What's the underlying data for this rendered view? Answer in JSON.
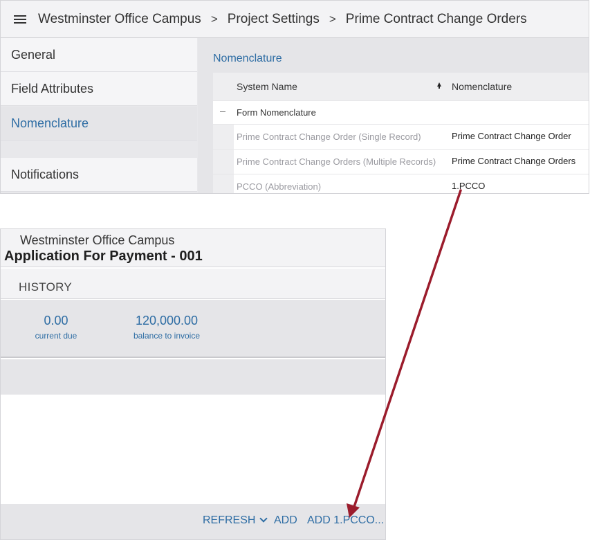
{
  "breadcrumb": [
    "Westminster Office Campus",
    "Project Settings",
    "Prime Contract Change Orders"
  ],
  "breadcrumb_separator": ">",
  "sidebar": {
    "items": [
      {
        "label": "General"
      },
      {
        "label": "Field Attributes"
      },
      {
        "label": "Nomenclature",
        "active": true
      },
      {
        "label": "Notifications"
      }
    ]
  },
  "nomenclature": {
    "section_title": "Nomenclature",
    "columns": {
      "system_name": "System Name",
      "nomenclature": "Nomenclature"
    },
    "group_label": "Form Nomenclature",
    "rows": [
      {
        "system": "Prime Contract Change Order (Single Record)",
        "value": "Prime Contract Change Order"
      },
      {
        "system": "Prime Contract Change Orders (Multiple Records)",
        "value": "Prime Contract Change Orders"
      },
      {
        "system": "PCCO (Abbreviation)",
        "value": "1.PCCO"
      }
    ]
  },
  "payment": {
    "project": "Westminster Office Campus",
    "title": "Application For Payment - 001",
    "history_label": "HISTORY",
    "current_due_value": "0.00",
    "current_due_label": "current due",
    "balance_value": "120,000.00",
    "balance_label": "balance to invoice"
  },
  "footer": {
    "refresh_label": "REFRESH",
    "add_label": "ADD",
    "add_pcco_label": "ADD 1.PCCO..."
  },
  "colors": {
    "accent": "#2e6da4",
    "arrow": "#9b1c2c"
  }
}
